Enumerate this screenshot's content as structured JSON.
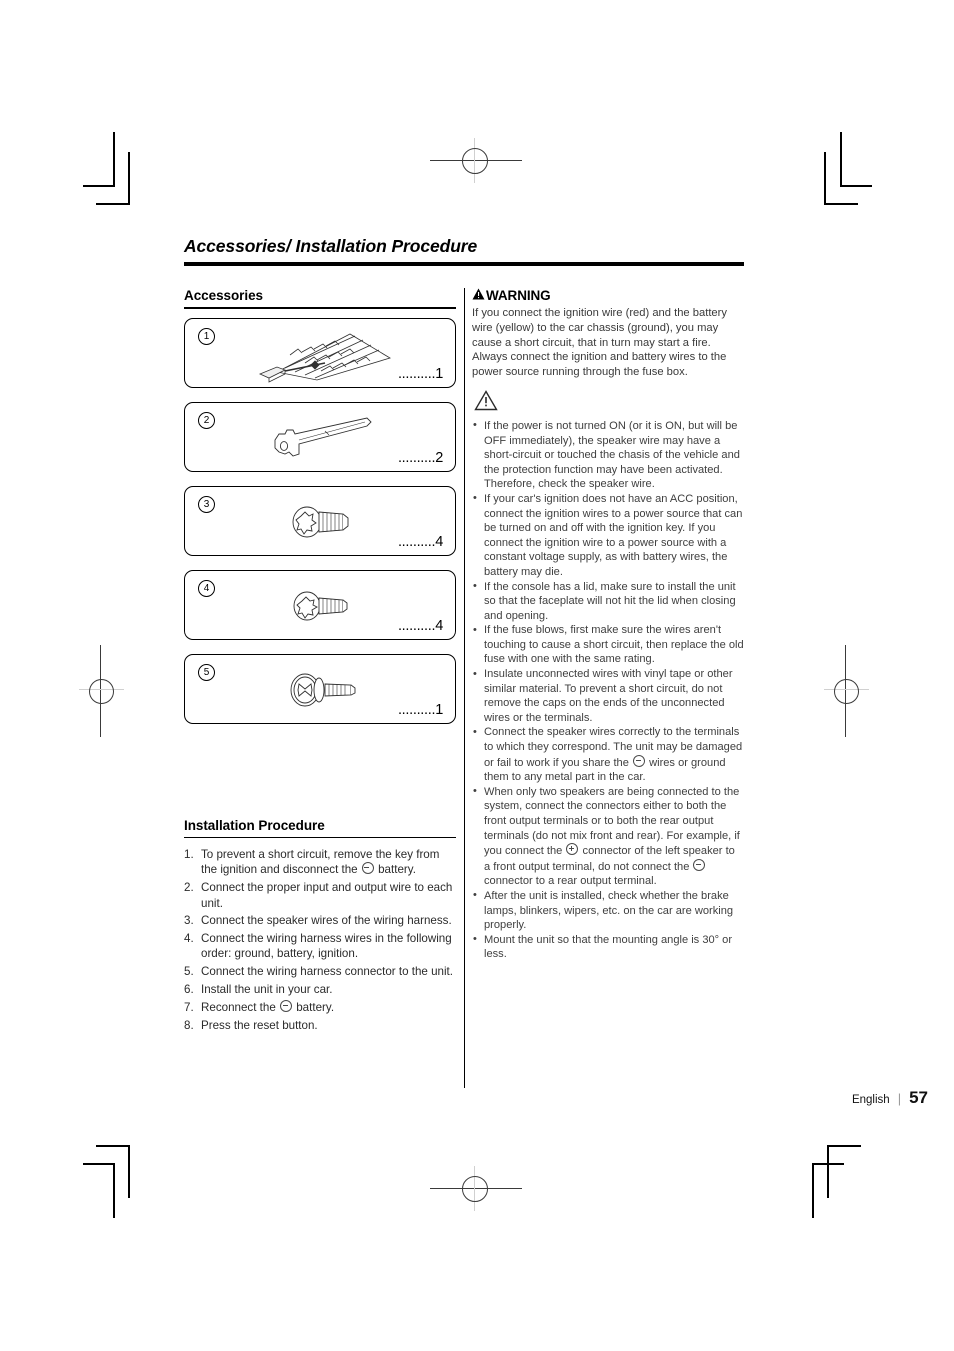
{
  "page": {
    "title": "Accessories/ Installation Procedure",
    "footer": {
      "language": "English",
      "separator": "|",
      "page_number": "57"
    }
  },
  "accessories": {
    "heading": "Accessories",
    "items": [
      {
        "number": "1",
        "icon": "wiring-harness-icon",
        "leader": "..........",
        "quantity": "1"
      },
      {
        "number": "2",
        "icon": "extraction-key-icon",
        "leader": "..........",
        "quantity": "2"
      },
      {
        "number": "3",
        "icon": "flat-head-screw-icon",
        "leader": "..........",
        "quantity": "4"
      },
      {
        "number": "4",
        "icon": "pan-head-screw-icon",
        "leader": "..........",
        "quantity": "4"
      },
      {
        "number": "5",
        "icon": "washer-screw-icon",
        "leader": "..........",
        "quantity": "1"
      }
    ]
  },
  "installation": {
    "heading": "Installation Procedure",
    "steps": [
      {
        "n": "1.",
        "text_before": "To prevent a short circuit, remove the key from the ignition and disconnect the",
        "polarity": "minus",
        "text_after": "battery."
      },
      {
        "n": "2.",
        "text_before": "Connect the proper input and output wire to each unit.",
        "polarity": "",
        "text_after": ""
      },
      {
        "n": "3.",
        "text_before": "Connect the speaker wires of the wiring harness.",
        "polarity": "",
        "text_after": ""
      },
      {
        "n": "4.",
        "text_before": "Connect the wiring harness wires in the following order: ground, battery, ignition.",
        "polarity": "",
        "text_after": ""
      },
      {
        "n": "5.",
        "text_before": "Connect the wiring harness connector to the unit.",
        "polarity": "",
        "text_after": ""
      },
      {
        "n": "6.",
        "text_before": "Install the unit in your car.",
        "polarity": "",
        "text_after": ""
      },
      {
        "n": "7.",
        "text_before": "Reconnect the",
        "polarity": "minus",
        "text_after": "battery."
      },
      {
        "n": "8.",
        "text_before": "Press the reset button.",
        "polarity": "",
        "text_after": ""
      }
    ]
  },
  "warning": {
    "heading": "WARNING",
    "warning_icon": "warning-triangle-icon",
    "body": "If you connect the ignition wire (red) and the battery wire (yellow) to the car chassis (ground), you may cause a short circuit, that in turn may start a fire. Always connect the ignition and battery wires to the power source running through the fuse box.",
    "caution_icon": "caution-triangle-icon",
    "bullet_char": "•",
    "bullets": [
      {
        "text_before": "If the power is not turned ON (or it is ON, but will be OFF immediately), the speaker wire may have a short-circuit or touched the chasis of the vehicle and the protection function may have been activated. Therefore, check the speaker wire.",
        "polarity": "",
        "text_mid": "",
        "polarity2": "",
        "text_after": ""
      },
      {
        "text_before": "If your car's ignition does not have an ACC position, connect the ignition wires to a power source that can be turned on and off with the ignition key. If you connect the ignition wire to a power source with a constant voltage supply, as with battery wires, the battery may die.",
        "polarity": "",
        "text_mid": "",
        "polarity2": "",
        "text_after": ""
      },
      {
        "text_before": "If the console has a lid, make sure to install the unit so that the faceplate will not hit the lid when closing and opening.",
        "polarity": "",
        "text_mid": "",
        "polarity2": "",
        "text_after": ""
      },
      {
        "text_before": "If the fuse blows, first make sure the wires aren't touching to cause a short circuit, then replace the old fuse with one with the same rating.",
        "polarity": "",
        "text_mid": "",
        "polarity2": "",
        "text_after": ""
      },
      {
        "text_before": "Insulate unconnected wires with vinyl tape or other similar material. To prevent a short circuit, do not remove the caps on the ends of the unconnected wires or the terminals.",
        "polarity": "",
        "text_mid": "",
        "polarity2": "",
        "text_after": ""
      },
      {
        "text_before": "Connect the speaker wires correctly to the terminals to which they correspond. The unit may be damaged or fail to work if you share the",
        "polarity": "minus",
        "text_mid": "wires or ground them to any metal part in the car.",
        "polarity2": "",
        "text_after": ""
      },
      {
        "text_before": "When only two speakers are being connected to the system, connect the connectors either to both the front output terminals or to both the rear output terminals (do not mix front and rear). For example, if you connect the",
        "polarity": "plus",
        "text_mid": "connector of the left speaker to a front output terminal, do not connect the",
        "polarity2": "minus",
        "text_after": "connector to a rear output terminal."
      },
      {
        "text_before": "After the unit is installed, check whether the brake lamps, blinkers, wipers, etc. on the car are working properly.",
        "polarity": "",
        "text_mid": "",
        "polarity2": "",
        "text_after": ""
      },
      {
        "text_before": "Mount the unit so that the mounting angle is 30° or less.",
        "polarity": "",
        "text_mid": "",
        "polarity2": "",
        "text_after": ""
      }
    ]
  }
}
